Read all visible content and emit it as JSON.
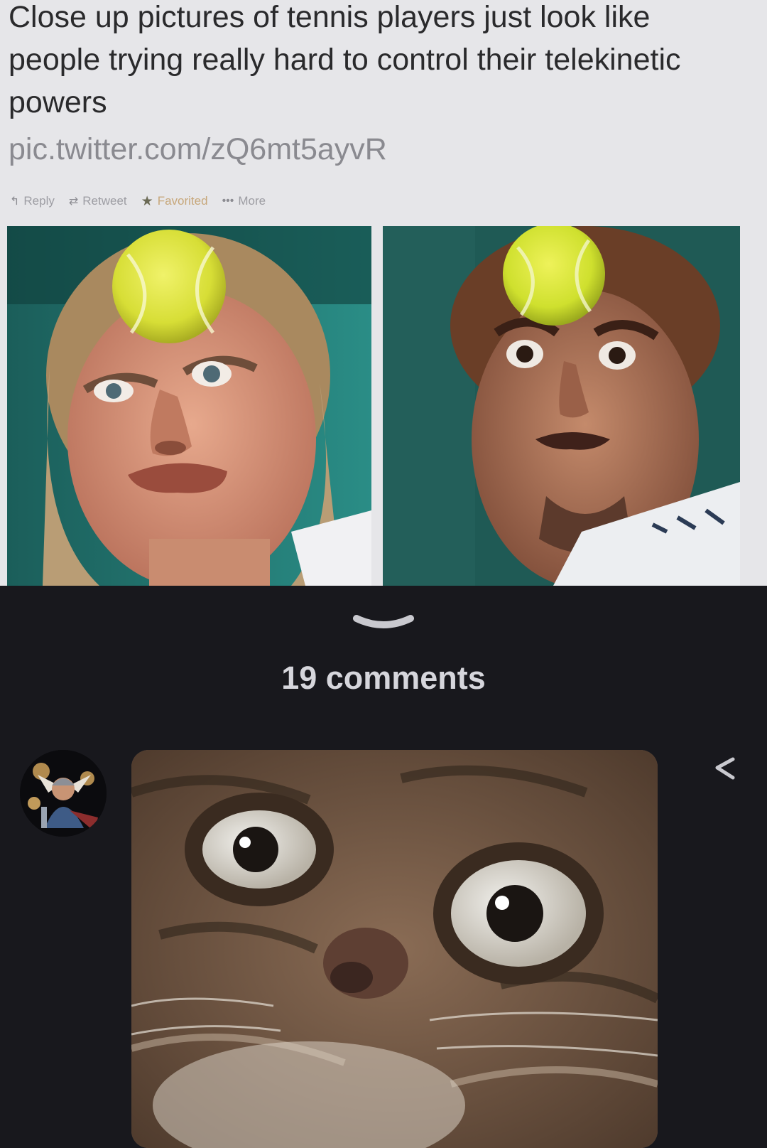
{
  "tweet": {
    "text": "Close up pictures of tennis players just look like people trying really hard to control their telekinetic powers",
    "link": "pic.twitter.com/zQ6mt5ayvR",
    "actions": [
      {
        "icon": "reply-icon",
        "label": "Reply"
      },
      {
        "icon": "retweet-icon",
        "label": "Retweet"
      },
      {
        "icon": "star-icon",
        "label": "Favorited"
      },
      {
        "icon": "more-icon",
        "label": "More"
      }
    ]
  },
  "comments_header": {
    "count_label": "19 comments"
  },
  "colors": {
    "page_bg": "#18181d",
    "tweet_bg": "#e6e6e9",
    "tweet_text": "#2a2a2c",
    "link_gray": "#8a8a90",
    "favorited_gold": "#c7a77a",
    "comment_count_text": "#d6d6dc",
    "tennis_ball": "#d9e23a"
  }
}
